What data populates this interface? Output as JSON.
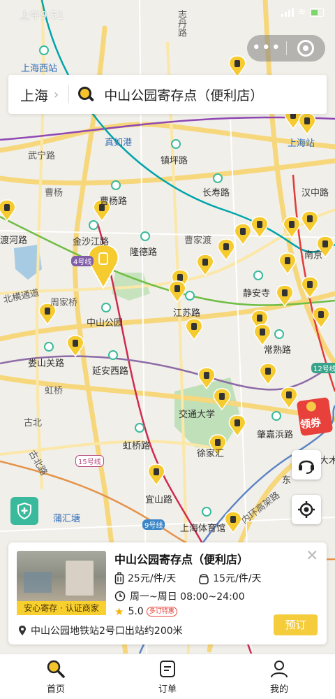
{
  "status_bar": {
    "time": "上午9:51"
  },
  "search": {
    "city": "上海",
    "query": "中山公园寄存点（便利店）"
  },
  "map": {
    "labels": {
      "shanghai_west": "上海西站",
      "zhidan_rd": "志丹路",
      "wuning_rd": "武宁路",
      "zhenru_port": "真如港",
      "zhenping_rd": "镇坪路",
      "caoyang": "曹杨",
      "caoyang_rd": "曹杨路",
      "changshou_rd": "长寿路",
      "shanghai_station": "上海站",
      "hanzhong_rd": "汉中路",
      "duhe_rd": "渡河路",
      "jinshajiang_rd": "金沙江路",
      "longde_rd": "隆德路",
      "caojiadu": "曹家渡",
      "line4": "4号线",
      "nanjing": "南京",
      "beiheng": "北横通道",
      "zhoujiaqiao": "周家桥",
      "jingan_temple": "静安寺",
      "jiangsu_rd": "江苏路",
      "zhongshan_park": "中山公园",
      "changshu_rd": "常熟路",
      "loushanguan_rd": "娄山关路",
      "yanan_w_rd": "延安西路",
      "line12": "12号线",
      "hongqiao": "虹桥",
      "jiaotong_univ": "交通大学",
      "gubei": "古北",
      "zhaojiabang_rd": "肇嘉浜路",
      "hongqiao_rd": "虹桥路",
      "xujiahui": "徐家汇",
      "line15": "15号线",
      "dashijie": "大木",
      "gubei_rd": "古北路",
      "dong": "东",
      "yishan_rd": "宜山路",
      "inner_ring": "内环高架路",
      "puhuitang": "蒲汇塘",
      "line9": "9号线",
      "sh_stadium": "上海体育馆"
    }
  },
  "coupon": {
    "label": "领券"
  },
  "store_card": {
    "title": "中山公园寄存点（便利店）",
    "badge": "安心寄存 · 认证商家",
    "price_large": "25元/件/天",
    "price_small": "15元/件/天",
    "hours": "周一~周日 08:00~24:00",
    "rating": "5.0",
    "promo_tag": "多订特惠",
    "book_label": "预订",
    "address": "中山公园地铁站2号口出站约200米"
  },
  "tab_bar": {
    "items": [
      {
        "label": "首页"
      },
      {
        "label": "订单"
      },
      {
        "label": "我的"
      }
    ]
  },
  "colors": {
    "accent": "#f5cc3c",
    "pin": "#f5cb30",
    "metro_green": "#3aba9c"
  }
}
